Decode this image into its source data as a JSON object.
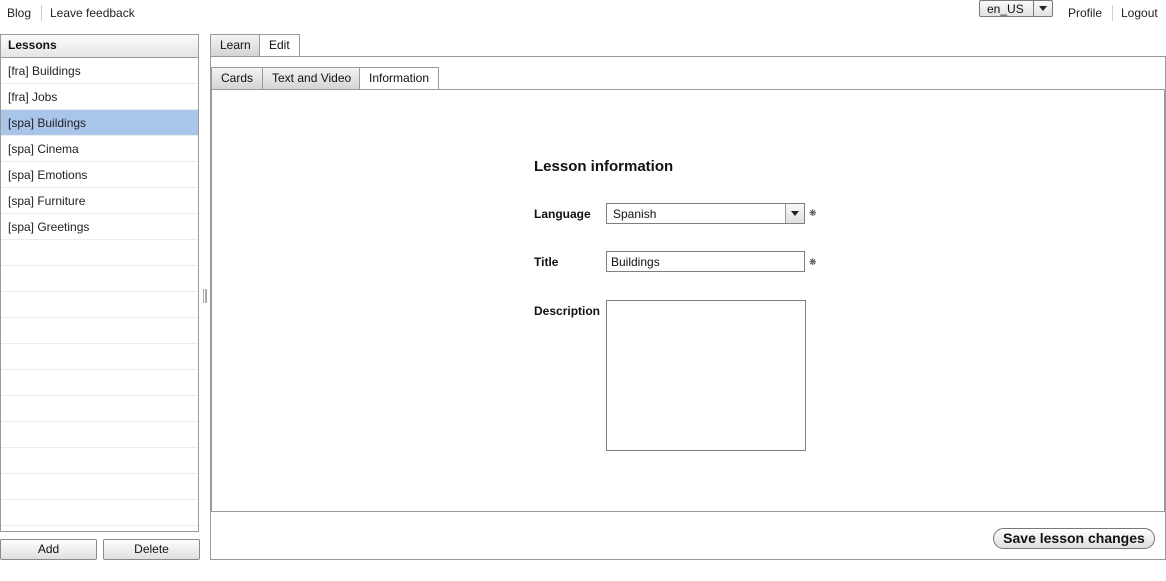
{
  "topnav": {
    "blog": "Blog",
    "feedback": "Leave feedback",
    "locale": "en_US",
    "profile": "Profile",
    "logout": "Logout"
  },
  "lessons": {
    "header": "Lessons",
    "items": [
      "[fra] Buildings",
      "[fra] Jobs",
      "[spa] Buildings",
      "[spa] Cinema",
      "[spa] Emotions",
      "[spa] Furniture",
      "[spa] Greetings"
    ],
    "selected_index": 2,
    "add_label": "Add",
    "delete_label": "Delete"
  },
  "main_tabs": {
    "learn": "Learn",
    "edit": "Edit"
  },
  "sub_tabs": {
    "cards": "Cards",
    "text_video": "Text and Video",
    "information": "Information"
  },
  "form": {
    "title": "Lesson information",
    "language_label": "Language",
    "language_value": "Spanish",
    "title_label": "Title",
    "title_value": "Buildings",
    "description_label": "Description",
    "description_value": "",
    "required_mark": "❋"
  },
  "save_label": "Save lesson changes",
  "colors": {
    "selected_row": "#a9c5ea"
  }
}
